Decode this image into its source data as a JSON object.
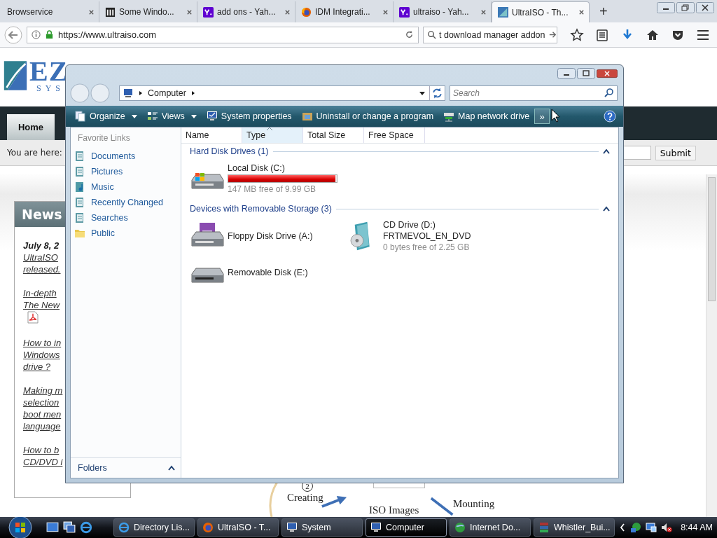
{
  "browser": {
    "tabs": [
      {
        "label": "Browservice",
        "selected": false
      },
      {
        "label": "Some Windo...",
        "selected": false
      },
      {
        "label": "add ons - Yah...",
        "selected": false
      },
      {
        "label": "IDM Integrati...",
        "selected": false
      },
      {
        "label": "ultraiso - Yah...",
        "selected": false
      },
      {
        "label": "UltraISO - Th...",
        "selected": true
      }
    ],
    "new_tab": "+",
    "url": "https://www.ultraiso.com",
    "search_value": "t download manager addon"
  },
  "website": {
    "logo": {
      "letters": "EZ",
      "subtitle": "SYS"
    },
    "nav_tabs": [
      {
        "label": "Home",
        "selected": true
      }
    ],
    "breadcrumb": "You are here:",
    "submit": "Submit",
    "news": {
      "title": "News",
      "items": [
        {
          "kind": "date",
          "text": "July 8, 2"
        },
        {
          "kind": "link",
          "text": "UltraISO"
        },
        {
          "kind": "link",
          "text": "released."
        },
        {
          "kind": "gap"
        },
        {
          "kind": "link",
          "text": "In-depth"
        },
        {
          "kind": "link",
          "text": "The New"
        },
        {
          "kind": "pdf"
        },
        {
          "kind": "gap"
        },
        {
          "kind": "link",
          "text": "How to in"
        },
        {
          "kind": "link",
          "text": "Windows"
        },
        {
          "kind": "link",
          "text": "drive ?"
        },
        {
          "kind": "gap"
        },
        {
          "kind": "link",
          "text": "Making m"
        },
        {
          "kind": "link",
          "text": "selection"
        },
        {
          "kind": "link",
          "text": "boot men"
        },
        {
          "kind": "link",
          "text": "language"
        },
        {
          "kind": "gap"
        },
        {
          "kind": "link",
          "text": "How to b"
        },
        {
          "kind": "link",
          "text": "CD/DVD i"
        }
      ]
    },
    "diagram": {
      "step": "2",
      "labels": [
        "Creating",
        "ISO Images",
        "Mounting"
      ]
    }
  },
  "explorer": {
    "address": "Computer",
    "search_placeholder": "Search",
    "toolbar": [
      {
        "label": "Organize",
        "dropdown": true
      },
      {
        "label": "Views",
        "dropdown": true
      },
      {
        "label": "System properties",
        "dropdown": false
      },
      {
        "label": "Uninstall or change a program",
        "dropdown": false
      },
      {
        "label": "Map network drive",
        "dropdown": false
      }
    ],
    "more": "»",
    "favorites_title": "Favorite Links",
    "favorites": [
      {
        "label": "Documents"
      },
      {
        "label": "Pictures"
      },
      {
        "label": "Music"
      },
      {
        "label": "Recently Changed"
      },
      {
        "label": "Searches"
      },
      {
        "label": "Public"
      }
    ],
    "folders": "Folders",
    "columns": [
      {
        "label": "Name",
        "selected": false
      },
      {
        "label": "Type",
        "selected": true
      },
      {
        "label": "Total Size",
        "selected": false
      },
      {
        "label": "Free Space",
        "selected": false
      }
    ],
    "groups": [
      {
        "title": "Hard Disk Drives (1)",
        "expanded": true,
        "items": [
          {
            "kind": "hdd",
            "name": "Local Disk (C:)",
            "level": 0.985,
            "detail": "147 MB free of 9.99 GB"
          }
        ]
      },
      {
        "title": "Devices with Removable Storage (3)",
        "expanded": true,
        "items": [
          {
            "kind": "floppy",
            "name": "Floppy Disk Drive (A:)"
          },
          {
            "kind": "cd",
            "name": "CD Drive (D:)",
            "label": "FRTMEVOL_EN_DVD",
            "detail": "0 bytes free of 2.25 GB"
          },
          {
            "kind": "removable",
            "name": "Removable Disk (E:)"
          }
        ]
      }
    ]
  },
  "taskbar": {
    "tasks": [
      {
        "label": "Directory Lis...",
        "selected": false
      },
      {
        "label": "UltraISO - T...",
        "selected": false
      },
      {
        "label": "System",
        "selected": false
      },
      {
        "label": "Computer",
        "selected": true
      },
      {
        "label": "Internet Do...",
        "selected": false
      },
      {
        "label": "Whistler_Bui...",
        "selected": false
      }
    ],
    "clock": "8:44 AM"
  }
}
